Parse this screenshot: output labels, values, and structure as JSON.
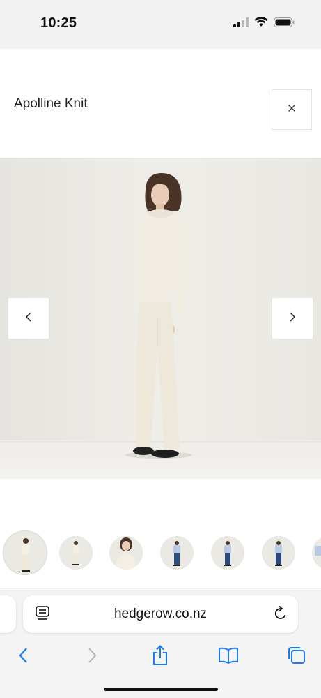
{
  "status": {
    "time": "10:25",
    "icons": [
      "signal-icon",
      "wifi-icon",
      "battery-icon"
    ]
  },
  "modal": {
    "title": "Apolline Knit",
    "close_icon": "close-icon"
  },
  "gallery": {
    "prev_icon": "chevron-left-icon",
    "next_icon": "chevron-right-icon",
    "thumbnail_count": 7
  },
  "browser": {
    "url": "hedgerow.co.nz",
    "reader_icon": "reader-mode-icon",
    "reload_icon": "reload-icon",
    "toolbar": [
      "back-icon",
      "forward-icon",
      "share-icon",
      "bookmarks-icon",
      "tabs-icon"
    ]
  },
  "colors": {
    "accent": "#1a7cf5",
    "disabled": "#b8b8bd",
    "backdrop": "#ebe9e4",
    "cream": "#f1ede2"
  }
}
